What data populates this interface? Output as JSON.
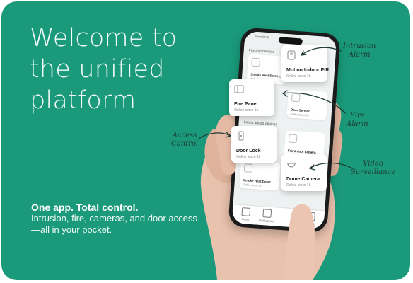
{
  "headline": [
    "Welcome to",
    "the unified",
    "platform"
  ],
  "tagline": {
    "bold": "One app. Total control.",
    "body": "Intrusion, fire, cameras, and door access—all in your pocket."
  },
  "phone": {
    "status_time": "Since 09:32",
    "section_favorites": "Favorite devices",
    "section_latest": "Latest added devices",
    "tiles": {
      "smoke1": {
        "name": "Smoke Heat Detec...",
        "status": "Online since 1h"
      },
      "door_sensor": {
        "name": "Door Sensor",
        "status": "Online since 1h"
      },
      "front_cam": {
        "name": "Front door camera",
        "status": "Online since 1h"
      },
      "smoke2": {
        "name": "Smoke Heat Detec...",
        "status": "Online since 1h"
      }
    },
    "nav": {
      "home": "Home",
      "notifications": "Notifications",
      "settings": "Settings"
    }
  },
  "popups": {
    "motion": {
      "name": "Motion Indoor PIR",
      "status": "Online since 1h",
      "icon": "motion-sensor-icon"
    },
    "fire": {
      "name": "Fire Panel",
      "status": "Online since 1h",
      "icon": "fire-panel-icon"
    },
    "door_lock": {
      "name": "Door Lock",
      "status": "Online since 1h",
      "icon": "door-lock-icon"
    },
    "dome": {
      "name": "Dome Camera",
      "status": "Online since 1h",
      "icon": "dome-camera-icon"
    }
  },
  "labels": {
    "intrusion": [
      "Intrusion",
      "Alarm"
    ],
    "fire": [
      "Fire",
      "Alarm"
    ],
    "access": [
      "Access",
      "Control"
    ],
    "video": [
      "Video",
      "Surveillance"
    ]
  },
  "colors": {
    "background": "#1a9a7b",
    "text": "#ffffff"
  }
}
